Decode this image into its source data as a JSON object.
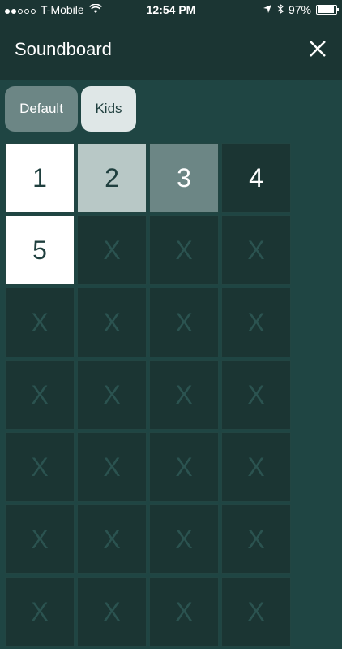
{
  "status_bar": {
    "carrier": "T-Mobile",
    "time": "12:54 PM",
    "battery": "97%"
  },
  "header": {
    "title": "Soundboard"
  },
  "tabs": [
    {
      "label": "Default"
    },
    {
      "label": "Kids"
    }
  ],
  "grid": {
    "row1": [
      "1",
      "2",
      "3",
      "4"
    ],
    "row2": [
      "5",
      "X",
      "X",
      "X"
    ],
    "row3": [
      "X",
      "X",
      "X",
      "X"
    ],
    "row4": [
      "X",
      "X",
      "X",
      "X"
    ],
    "row5": [
      "X",
      "X",
      "X",
      "X"
    ],
    "row6": [
      "X",
      "X",
      "X",
      "X"
    ],
    "row7": [
      "X",
      "X",
      "X",
      "X"
    ]
  }
}
